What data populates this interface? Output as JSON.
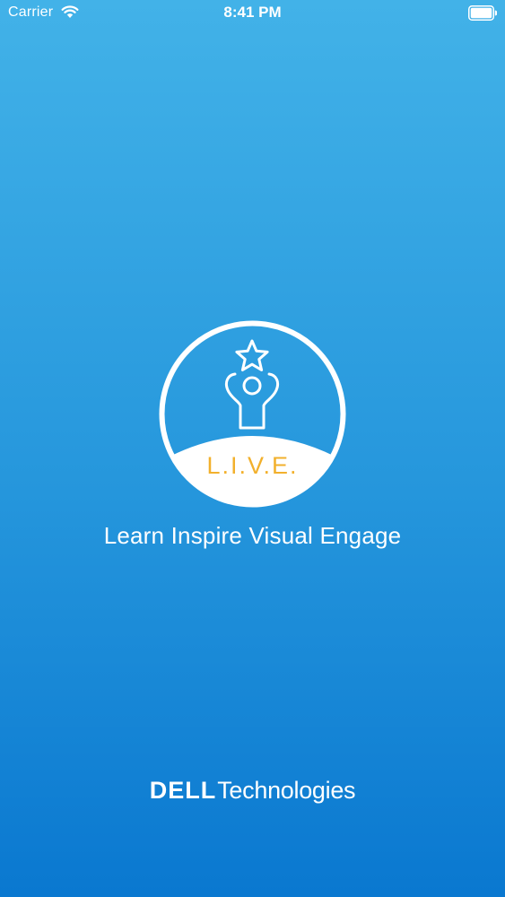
{
  "status_bar": {
    "carrier": "Carrier",
    "time": "8:41 PM",
    "icons": [
      "wifi-icon",
      "battery-icon"
    ]
  },
  "logo": {
    "icon": "person-reaching-star-icon",
    "text": "L.I.V.E.",
    "text_color": "#f2b02c"
  },
  "tagline": "Learn Inspire Visual Engage",
  "brand": {
    "company": "DELL",
    "suffix": "Technologies"
  },
  "colors": {
    "background_top": "#42b2e8",
    "background_bottom": "#0a78d0",
    "foreground": "#ffffff"
  }
}
